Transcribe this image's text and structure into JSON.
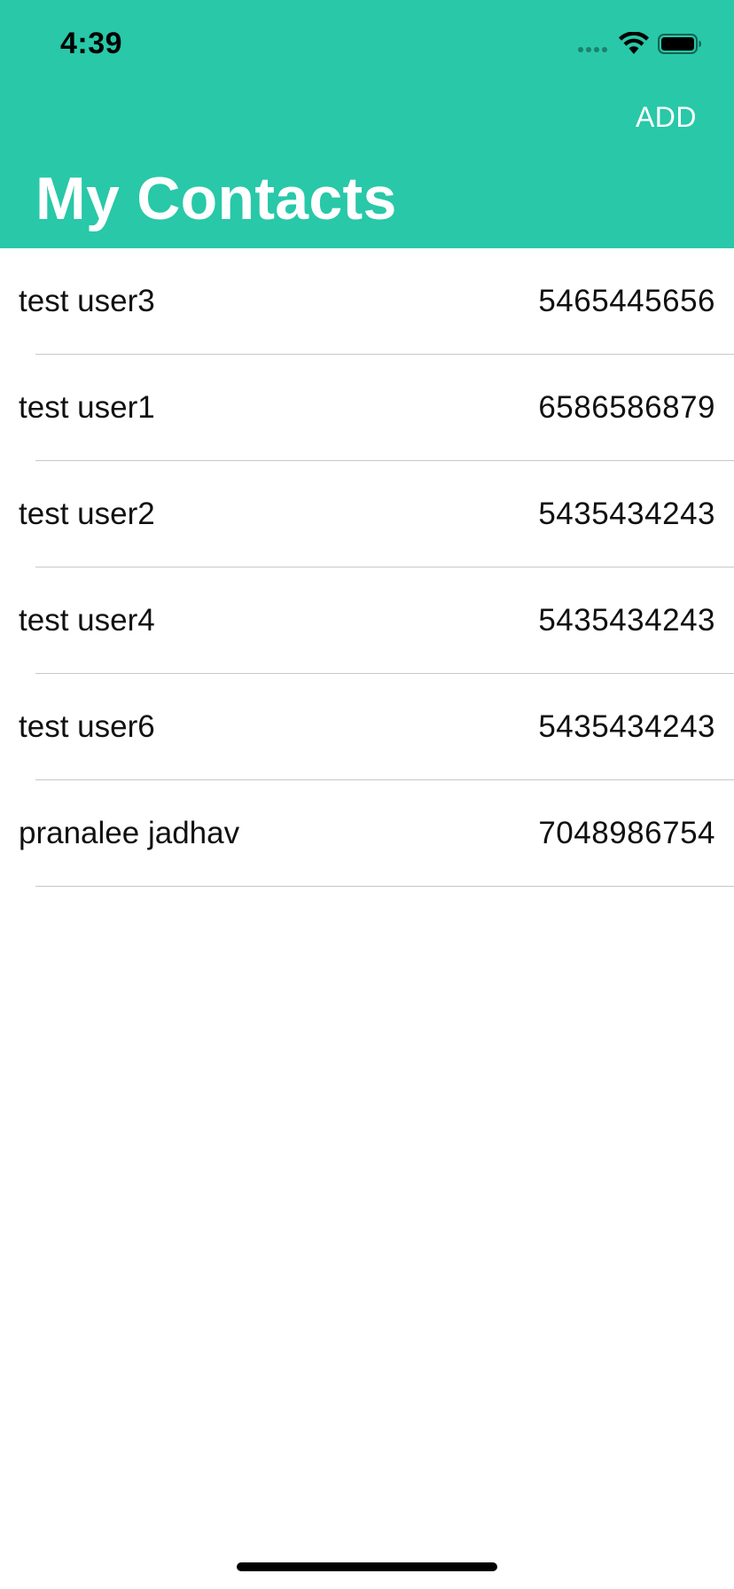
{
  "status_bar": {
    "time": "4:39",
    "icons": [
      "signal-dots-icon",
      "wifi-icon",
      "battery-icon"
    ]
  },
  "nav": {
    "add_label": "ADD",
    "title": "My Contacts"
  },
  "colors": {
    "header_bg": "#28c8a8",
    "header_text": "#ffffff",
    "divider": "#c8c8cc"
  },
  "contacts": [
    {
      "name": "test user3",
      "phone": "5465445656"
    },
    {
      "name": "test user1",
      "phone": "6586586879"
    },
    {
      "name": "test user2",
      "phone": "5435434243"
    },
    {
      "name": "test user4",
      "phone": "5435434243"
    },
    {
      "name": "test user6",
      "phone": "5435434243"
    },
    {
      "name": "pranalee jadhav",
      "phone": "7048986754"
    }
  ]
}
